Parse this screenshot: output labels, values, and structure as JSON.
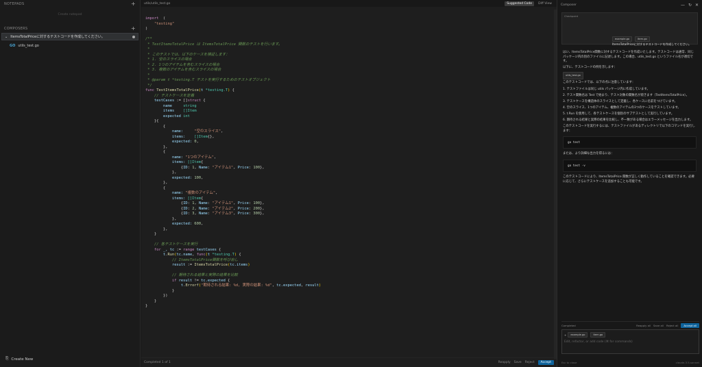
{
  "left": {
    "notepads_label": "NOTEPADS",
    "notepads_empty": "Create notepad",
    "composers_label": "COMPOSERS",
    "composer_title": "ItemsTotalPriceに対するテストコードを作成してください。",
    "file_name": "utils_test.go",
    "go_icon_text": "GO",
    "create_new": "Create New"
  },
  "editor": {
    "path": "utils/utils_test.go",
    "tab_suggested": "Suggested Code",
    "tab_diff": "Diff View",
    "footer_status": "Completed",
    "footer_page": "1 of 1",
    "actions": [
      "Reapply",
      "Save",
      "Reject"
    ],
    "accept_label": "Accept"
  },
  "code_lines": [
    [
      [
        "kw",
        "import"
      ],
      [
        "",
        "  ("
      ]
    ],
    [
      [
        "",
        "    "
      ],
      [
        "st",
        "\"testing\""
      ]
    ],
    [
      [
        "",
        ")"
      ]
    ],
    [
      [
        "",
        ""
      ]
    ],
    [
      [
        "cm",
        "/**"
      ]
    ],
    [
      [
        "cm",
        " * TestItemsTotalPrice は ItemsTotalPrice 関数のテストを行います。"
      ]
    ],
    [
      [
        "cm",
        " *"
      ]
    ],
    [
      [
        "cm",
        " * このテストでは、以下のケースを検証します："
      ]
    ],
    [
      [
        "cm",
        " * 1. 空のスライスの場合"
      ]
    ],
    [
      [
        "cm",
        " * 2. 1つのアイテムを含むスライスの場合"
      ]
    ],
    [
      [
        "cm",
        " * 3. 複数のアイテムを含むスライスの場合"
      ]
    ],
    [
      [
        "cm",
        " *"
      ]
    ],
    [
      [
        "cm",
        " * @param t *testing.T テストを実行するためのテストオブジェクト"
      ]
    ],
    [
      [
        "cm",
        " */"
      ]
    ],
    [
      [
        "kw",
        "func "
      ],
      [
        "fn",
        "TestItemsTotalPrice"
      ],
      [
        "br",
        "("
      ],
      [
        "vr",
        "t "
      ],
      [
        "ty",
        "*testing.T"
      ],
      [
        "br",
        ")"
      ],
      [
        "",
        " {"
      ]
    ],
    [
      [
        "cm",
        "    // テストケースを定義"
      ]
    ],
    [
      [
        "vr",
        "    testCases"
      ],
      [
        "",
        " := []"
      ],
      [
        "kw",
        "struct"
      ],
      [
        "",
        " {"
      ]
    ],
    [
      [
        "vr",
        "        name     "
      ],
      [
        "ty",
        "string"
      ]
    ],
    [
      [
        "vr",
        "        items    "
      ],
      [
        "",
        ""
      ],
      [
        "ty",
        "[]Item"
      ]
    ],
    [
      [
        "vr",
        "        expected "
      ],
      [
        "ty",
        "int"
      ]
    ],
    [
      [
        "",
        "    }{"
      ]
    ],
    [
      [
        "",
        "        {"
      ]
    ],
    [
      [
        "vr",
        "            name:     "
      ],
      [
        "st",
        "\"空のスライス\""
      ],
      [
        "",
        ","
      ]
    ],
    [
      [
        "vr",
        "            items:    "
      ],
      [
        "ty",
        "[]Item"
      ],
      [
        "",
        "{},"
      ]
    ],
    [
      [
        "vr",
        "            expected: "
      ],
      [
        "nu",
        "0"
      ],
      [
        "",
        ","
      ]
    ],
    [
      [
        "",
        "        },"
      ]
    ],
    [
      [
        "",
        "        {"
      ]
    ],
    [
      [
        "vr",
        "            name: "
      ],
      [
        "st",
        "\"1つのアイテム\""
      ],
      [
        "",
        ","
      ]
    ],
    [
      [
        "vr",
        "            items: "
      ],
      [
        "ty",
        "[]Item"
      ],
      [
        "",
        "{"
      ]
    ],
    [
      [
        "",
        "                {"
      ],
      [
        "vr",
        "ID"
      ],
      [
        ": "
      ],
      [
        "nu",
        "1"
      ],
      [
        ", "
      ],
      [
        "vr",
        "Name"
      ],
      [
        ": "
      ],
      [
        "st",
        "\"アイテム1\""
      ],
      [
        ", "
      ],
      [
        "vr",
        "Price"
      ],
      [
        ": "
      ],
      [
        "nu",
        "100"
      ],
      [
        "",
        "},"
      ]
    ],
    [
      [
        "",
        "            },"
      ]
    ],
    [
      [
        "vr",
        "            expected: "
      ],
      [
        "nu",
        "100"
      ],
      [
        "",
        ","
      ]
    ],
    [
      [
        "",
        "        },"
      ]
    ],
    [
      [
        "",
        "        {"
      ]
    ],
    [
      [
        "vr",
        "            name: "
      ],
      [
        "st",
        "\"複数のアイテム\""
      ],
      [
        "",
        ","
      ]
    ],
    [
      [
        "vr",
        "            items: "
      ],
      [
        "ty",
        "[]Item"
      ],
      [
        "",
        "{"
      ]
    ],
    [
      [
        "",
        "                {"
      ],
      [
        "vr",
        "ID"
      ],
      [
        ": "
      ],
      [
        "nu",
        "1"
      ],
      [
        ", "
      ],
      [
        "vr",
        "Name"
      ],
      [
        ": "
      ],
      [
        "st",
        "\"アイテム1\""
      ],
      [
        ", "
      ],
      [
        "vr",
        "Price"
      ],
      [
        ": "
      ],
      [
        "nu",
        "100"
      ],
      [
        "",
        "},"
      ]
    ],
    [
      [
        "",
        "                {"
      ],
      [
        "vr",
        "ID"
      ],
      [
        ": "
      ],
      [
        "nu",
        "2"
      ],
      [
        ", "
      ],
      [
        "vr",
        "Name"
      ],
      [
        ": "
      ],
      [
        "st",
        "\"アイテム2\""
      ],
      [
        ", "
      ],
      [
        "vr",
        "Price"
      ],
      [
        ": "
      ],
      [
        "nu",
        "200"
      ],
      [
        "",
        "},"
      ]
    ],
    [
      [
        "",
        "                {"
      ],
      [
        "vr",
        "ID"
      ],
      [
        ": "
      ],
      [
        "nu",
        "3"
      ],
      [
        ", "
      ],
      [
        "vr",
        "Name"
      ],
      [
        ": "
      ],
      [
        "st",
        "\"アイテム3\""
      ],
      [
        ", "
      ],
      [
        "vr",
        "Price"
      ],
      [
        ": "
      ],
      [
        "nu",
        "300"
      ],
      [
        "",
        "},"
      ]
    ],
    [
      [
        "",
        "            },"
      ]
    ],
    [
      [
        "vr",
        "            expected: "
      ],
      [
        "nu",
        "600"
      ],
      [
        "",
        ","
      ]
    ],
    [
      [
        "",
        "        },"
      ]
    ],
    [
      [
        "",
        "    }"
      ]
    ],
    [
      [
        "",
        ""
      ]
    ],
    [
      [
        "cm",
        "    // 各テストケースを実行"
      ]
    ],
    [
      [
        "kw",
        "    for "
      ],
      [
        "vr",
        "_, tc"
      ],
      [
        "",
        " := "
      ],
      [
        "kw",
        "range "
      ],
      [
        "vr",
        "testCases"
      ],
      [
        "",
        " {"
      ]
    ],
    [
      [
        "vr",
        "        t"
      ],
      [
        "",
        "."
      ],
      [
        "fn",
        "Run"
      ],
      [
        "br",
        "("
      ],
      [
        "vr",
        "tc.name"
      ],
      [
        ", "
      ],
      [
        "kw",
        "func"
      ],
      [
        "br",
        "("
      ],
      [
        "vr",
        "t "
      ],
      [
        "ty",
        "*testing.T"
      ],
      [
        "br",
        ")"
      ],
      [
        "",
        " {"
      ]
    ],
    [
      [
        "cm",
        "            // ItemsTotalPrice関数を呼び出し"
      ]
    ],
    [
      [
        "vr",
        "            result"
      ],
      [
        "",
        " := "
      ],
      [
        "fn",
        "ItemsTotalPrice"
      ],
      [
        "br",
        "("
      ],
      [
        "vr",
        "tc.items"
      ],
      [
        "br",
        ")"
      ]
    ],
    [
      [
        "",
        ""
      ]
    ],
    [
      [
        "cm",
        "            // 期待される結果と実際の結果を比較"
      ]
    ],
    [
      [
        "kw",
        "            if "
      ],
      [
        "vr",
        "result"
      ],
      [
        "",
        " != "
      ],
      [
        "vr",
        "tc.expected"
      ],
      [
        "",
        " {"
      ]
    ],
    [
      [
        "vr",
        "                t"
      ],
      [
        "",
        "."
      ],
      [
        "fn",
        "Errorf"
      ],
      [
        "br",
        "("
      ],
      [
        "st",
        "\"期待される結果: %d, 実際の結果: %d\""
      ],
      [
        ", "
      ],
      [
        "vr",
        "tc.expected"
      ],
      [
        ", "
      ],
      [
        "vr",
        "result"
      ],
      [
        "br",
        ")"
      ]
    ],
    [
      [
        "",
        "            }"
      ]
    ],
    [
      [
        "",
        "        })"
      ]
    ],
    [
      [
        "",
        "    }"
      ]
    ],
    [
      [
        "",
        "}"
      ]
    ]
  ],
  "composer": {
    "header_title": "Composer",
    "context_tag": "Checkpoint",
    "chip1": "example.go",
    "chip2": "item.go",
    "user_message": "ItemsTotalPriceに対するテストコードを作成してください。",
    "answer_intro": "はい、ItemsTotalPrice関数に対するテストコードを作成いたします。テストコードは通常、同じパッケージ内の別のファイルに記述します。この場合、utils_test.go というファイル名が適切です。",
    "answer_example": "以下に、テストコードの例を示します：",
    "file_chip": "utils_test.go",
    "cases_intro": "このテストコードでは、以下の点に注意しています：",
    "points": [
      "1. テストファイルは同じ utils パッケージ内に作成しています。",
      "2. テスト関数名は Test で始まり、テスト対象の関数名が続きます（TestItemsTotalPrice）。",
      "3. テストケースを構造体のスライスとして定義し、各ケースに名前をつけています。",
      "4. 空のスライス、1つのアイテム、複数のアイテムの3つのケースをテストしています。",
      "5. t.Run を使用して、各テストケースを個別のサブテストとして実行しています。",
      "6. 期待される結果と実際の結果を比較し、不一致がある場合はエラーメッセージを出力します。"
    ],
    "run_intro": "このテストコードを実行するには、テストファイルがあるディレクトリで以下のコマンドを実行します：",
    "cmd1": "go test",
    "verbose_intro": "または、より詳細な出力を得るには：",
    "cmd2": "go test -v",
    "closing": "このテストコードにより、ItemsTotalPrice 関数が正しく動作していることを確認できます。必要に応じて、さらにテストケースを追加することも可能です。",
    "completed_label": "Completed",
    "completed_actions": [
      "Reapply all",
      "Save all",
      "Reject all"
    ],
    "accept_all": "Accept all",
    "input_chip1": "example.go",
    "input_chip2": "item.go",
    "input_placeholder": "Edit, refactor, or add code (⌘ for commands)",
    "footer_left": "Esc to close",
    "footer_right": "claude-3.5-sonnet"
  }
}
